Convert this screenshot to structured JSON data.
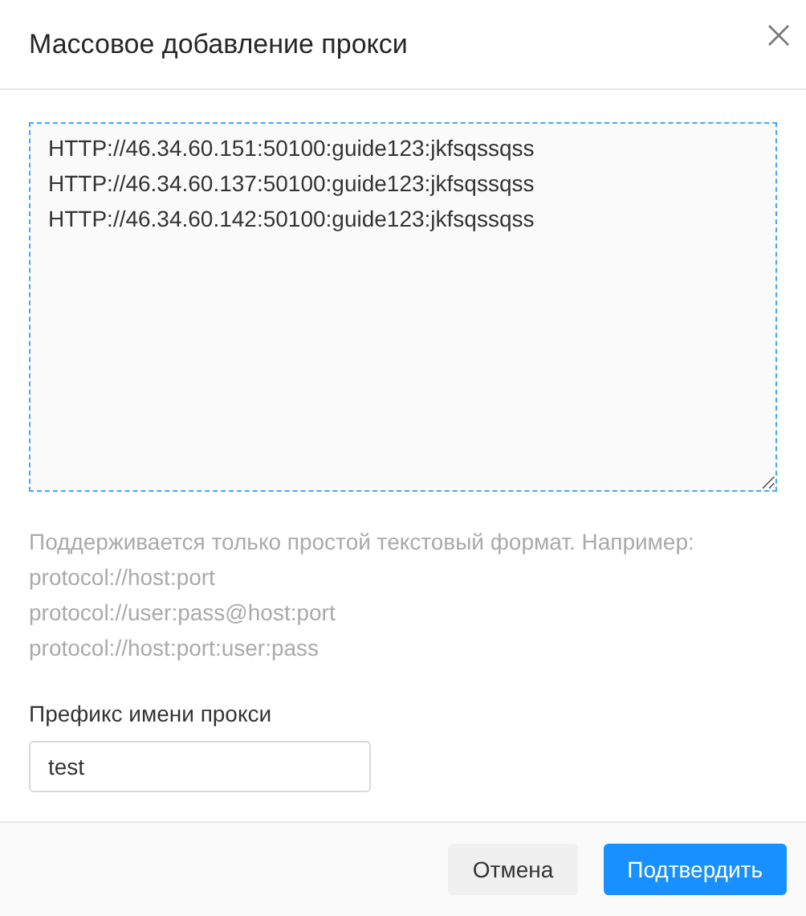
{
  "dialog": {
    "title": "Массовое добавление прокси"
  },
  "proxy_list": {
    "lines": [
      "HTTP://46.34.60.151:50100:guide123:jkfsqssqss",
      "HTTP://46.34.60.137:50100:guide123:jkfsqssqss",
      "HTTP://46.34.60.142:50100:guide123:jkfsqssqss"
    ]
  },
  "hint": {
    "lines": [
      "Поддерживается только простой текстовый формат. Например:",
      "protocol://host:port",
      "protocol://user:pass@host:port",
      "protocol://host:port:user:pass"
    ]
  },
  "prefix": {
    "label": "Префикс имени прокси",
    "value": "test"
  },
  "buttons": [
    {
      "label": "Отмена",
      "kind": "secondary"
    },
    {
      "label": "Подтвердить",
      "kind": "primary"
    }
  ]
}
